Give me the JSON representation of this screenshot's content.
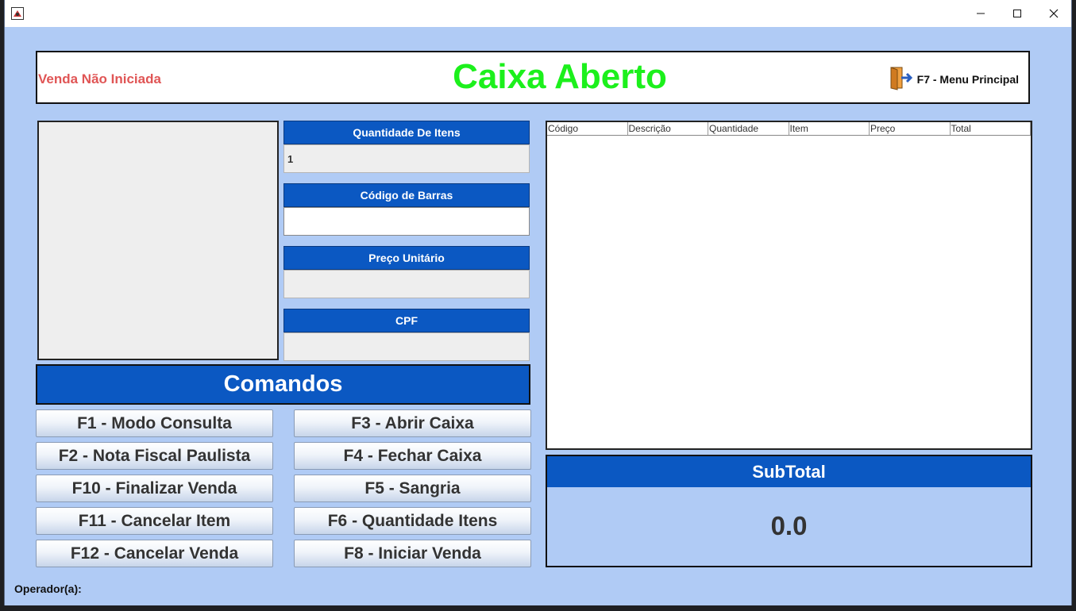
{
  "window": {
    "title": ""
  },
  "header": {
    "status": "Venda Não Iniciada",
    "title": "Caixa Aberto",
    "menu_label": "F7 - Menu Principal"
  },
  "fields": {
    "quantidade": {
      "label": "Quantidade De Itens",
      "value": "1"
    },
    "codigo": {
      "label": "Código de Barras",
      "value": ""
    },
    "preco": {
      "label": "Preço Unitário",
      "value": ""
    },
    "cpf": {
      "label": "CPF",
      "value": ""
    }
  },
  "comandos": {
    "title": "Comandos",
    "buttons": [
      "F1 - Modo Consulta",
      "F3 - Abrir Caixa",
      "F2 - Nota Fiscal Paulista",
      "F4 - Fechar Caixa",
      "F10 - Finalizar Venda",
      "F5 - Sangria",
      "F11 - Cancelar Item",
      "F6 - Quantidade Itens",
      "F12 - Cancelar Venda",
      "F8 - Iniciar Venda"
    ]
  },
  "table": {
    "columns": [
      "Código",
      "Descrição",
      "Quantidade",
      "Item",
      "Preço",
      "Total"
    ]
  },
  "subtotal": {
    "label": "SubTotal",
    "value": "0.0"
  },
  "footer": {
    "operator_label": "Operador(a):"
  },
  "colors": {
    "accent": "#0b58c2",
    "background": "#b0cbf5",
    "title_green": "#1cf01c",
    "status_red": "#e05555"
  }
}
